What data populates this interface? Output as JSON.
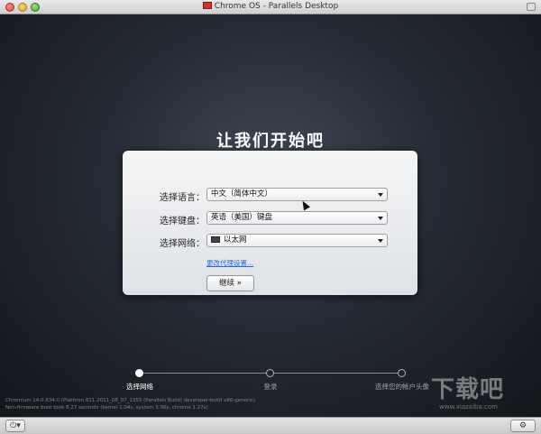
{
  "window": {
    "title": "Chrome OS - Parallels Desktop"
  },
  "setup": {
    "heading": "让我们开始吧",
    "language_label": "选择语言：",
    "language_value": "中文（简体中文）",
    "keyboard_label": "选择键盘：",
    "keyboard_value": "英语（美国）键盘",
    "network_label": "选择网络：",
    "network_value": "以太网",
    "proxy_link": "更改代理设置...",
    "continue_label": "继续 »"
  },
  "steps": [
    {
      "label": "选择网络",
      "active": true
    },
    {
      "label": "登录",
      "active": false
    },
    {
      "label": "选择您的帐户头像",
      "active": false
    }
  ],
  "build_info": {
    "line1": "Chromium 14.0.834.0 (Platform 811.2011_08_07_1355 (Parallels Build) developer-build x86-generic)",
    "line2": "Non-firmware boot took 8.27 seconds (kernel 1.04s, system 5.96s, chrome 1.27s)"
  },
  "watermark": {
    "text": "下载吧",
    "url": "www.xiazaiba.com"
  },
  "statusbar": {
    "power_icon": "power-icon",
    "settings_icon": "gear-icon"
  }
}
